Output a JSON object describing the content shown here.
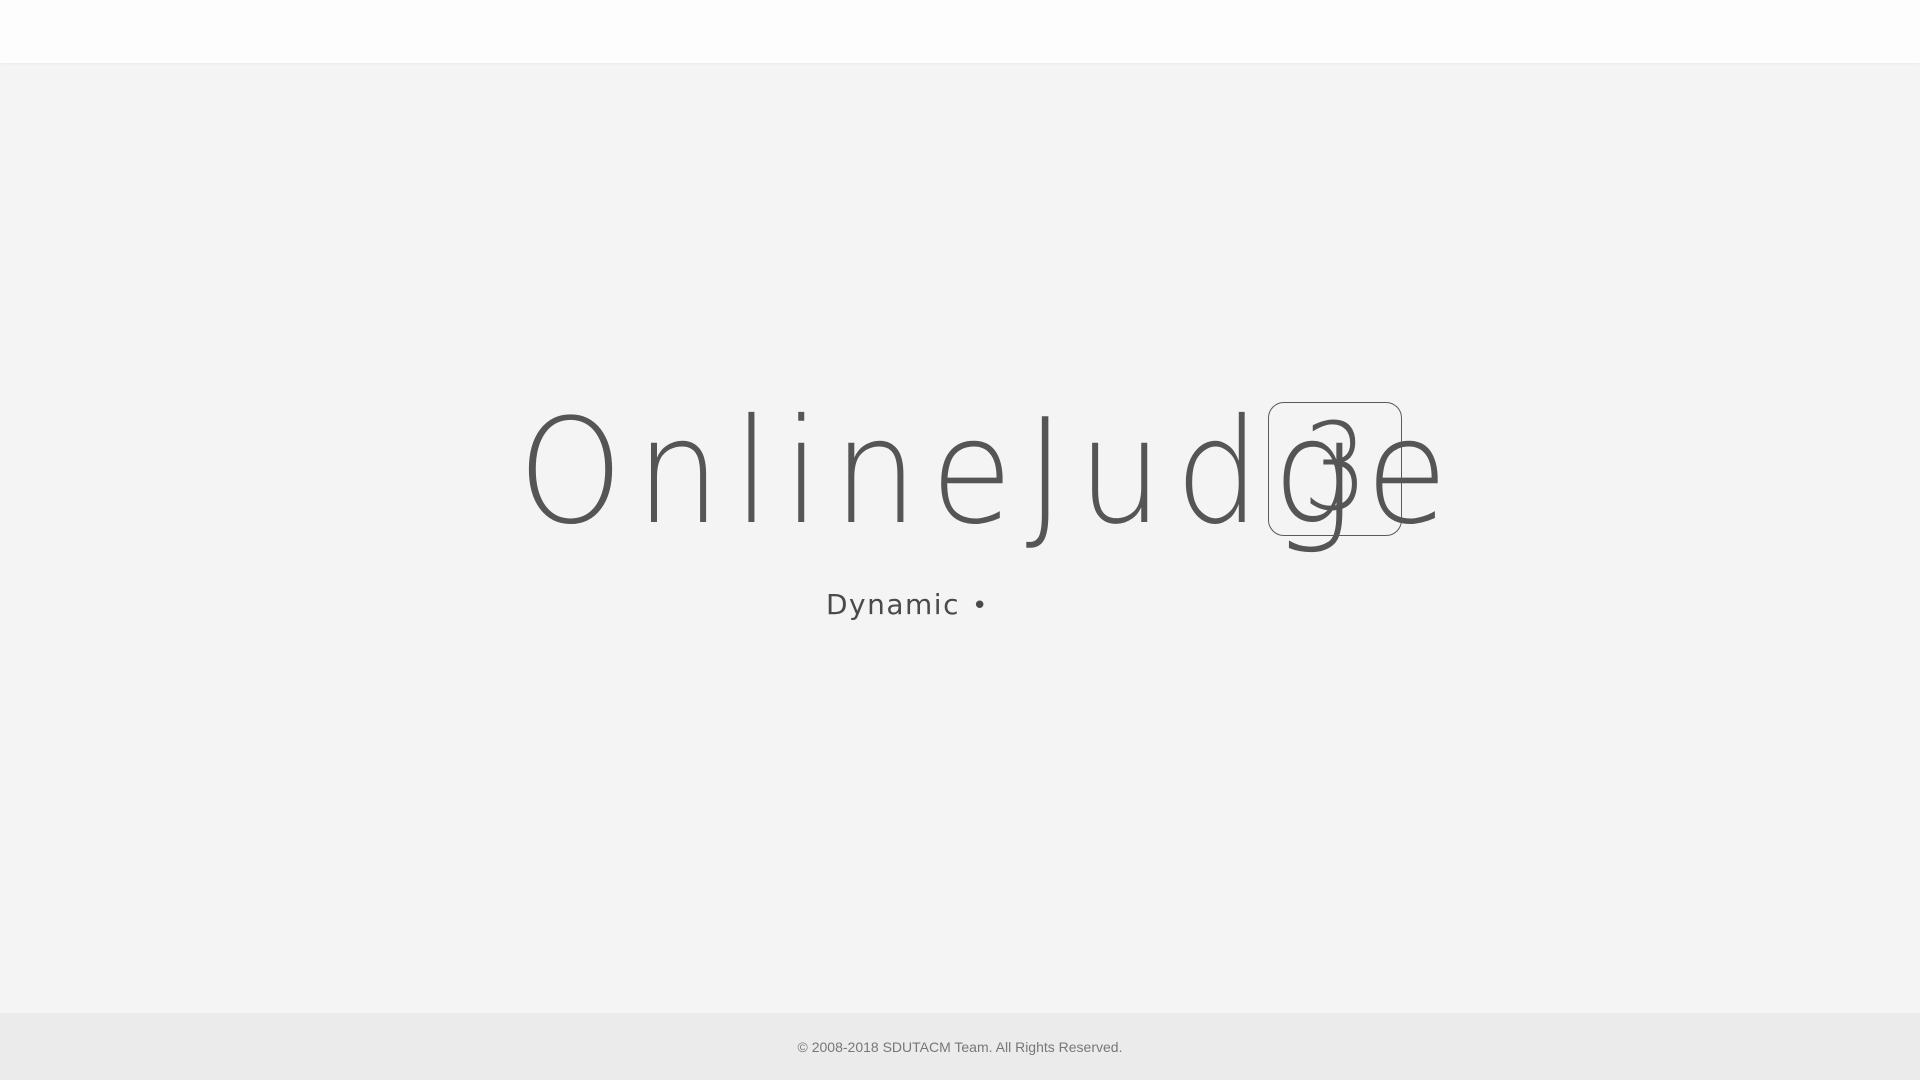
{
  "header": {},
  "hero": {
    "logo_text": "OnlineJudge",
    "version": "3",
    "tagline": "Dynamic",
    "tagline_dot": "•"
  },
  "footer": {
    "copyright": "© 2008-2018 SDUTACM Team. All Rights Reserved."
  }
}
